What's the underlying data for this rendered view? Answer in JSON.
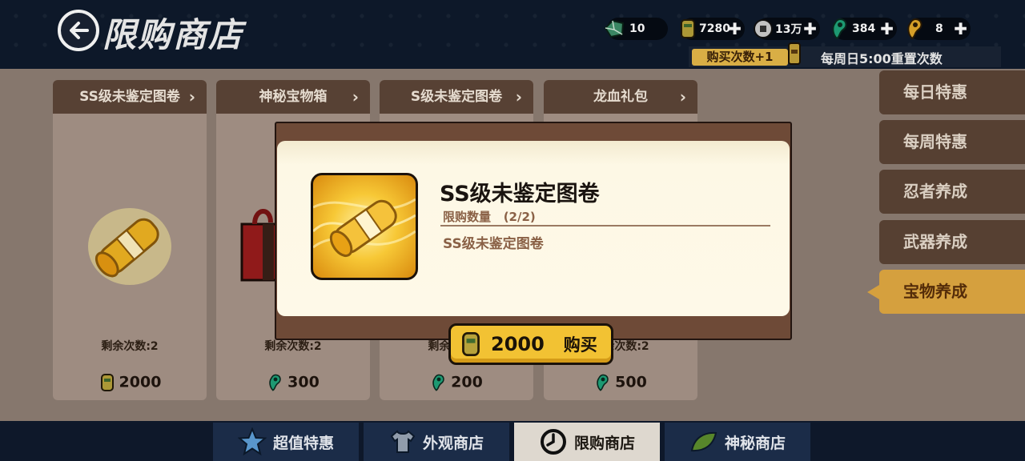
{
  "header": {
    "title": "限购商店",
    "resources": [
      {
        "icon": "jade-gem-icon",
        "value": "10"
      },
      {
        "icon": "ninja-coin-icon",
        "value": "7280"
      },
      {
        "icon": "silver-coin-icon",
        "value": "13万"
      },
      {
        "icon": "green-magatama-icon",
        "value": "384"
      },
      {
        "icon": "gold-magatama-icon",
        "value": "8"
      }
    ],
    "buy_times_label": "购买次数+1",
    "reset_label": "每周日5:00重置次数"
  },
  "cards": [
    {
      "title": "SS级未鉴定图卷",
      "remain": "剩余次数:2",
      "price": "2000",
      "currency_icon": "ninja-coin-icon"
    },
    {
      "title": "神秘宝物箱",
      "remain": "剩余次数:2",
      "price": "300",
      "currency_icon": "green-magatama-icon"
    },
    {
      "title": "S级未鉴定图卷",
      "remain": "剩余次数:2",
      "price": "200",
      "currency_icon": "green-magatama-icon"
    },
    {
      "title": "龙血礼包",
      "remain": "剩余次数:2",
      "price": "500",
      "currency_icon": "green-magatama-icon"
    }
  ],
  "side_menu": [
    {
      "label": "每日特惠",
      "active": false
    },
    {
      "label": "每周特惠",
      "active": false
    },
    {
      "label": "忍者养成",
      "active": false
    },
    {
      "label": "武器养成",
      "active": false
    },
    {
      "label": "宝物养成",
      "active": true
    }
  ],
  "bottom_tabs": [
    {
      "label": "超值特惠",
      "icon": "star-icon",
      "active": false
    },
    {
      "label": "外观商店",
      "icon": "shirt-icon",
      "active": false
    },
    {
      "label": "限购商店",
      "icon": "clock-icon",
      "active": true
    },
    {
      "label": "神秘商店",
      "icon": "leaf-icon",
      "active": false
    }
  ],
  "modal": {
    "item_name": "SS级未鉴定图卷",
    "limit_label": "限购数量",
    "limit_value": "(2/2)",
    "description": "SS级未鉴定图卷",
    "price": "2000",
    "buy_label": "购买",
    "currency_icon": "ninja-coin-icon"
  },
  "colors": {
    "accent_gold": "#f2c233",
    "panel_brown": "#5d4638",
    "header_navy": "#0e1a2c",
    "magatama_green": "#1fa37a"
  }
}
